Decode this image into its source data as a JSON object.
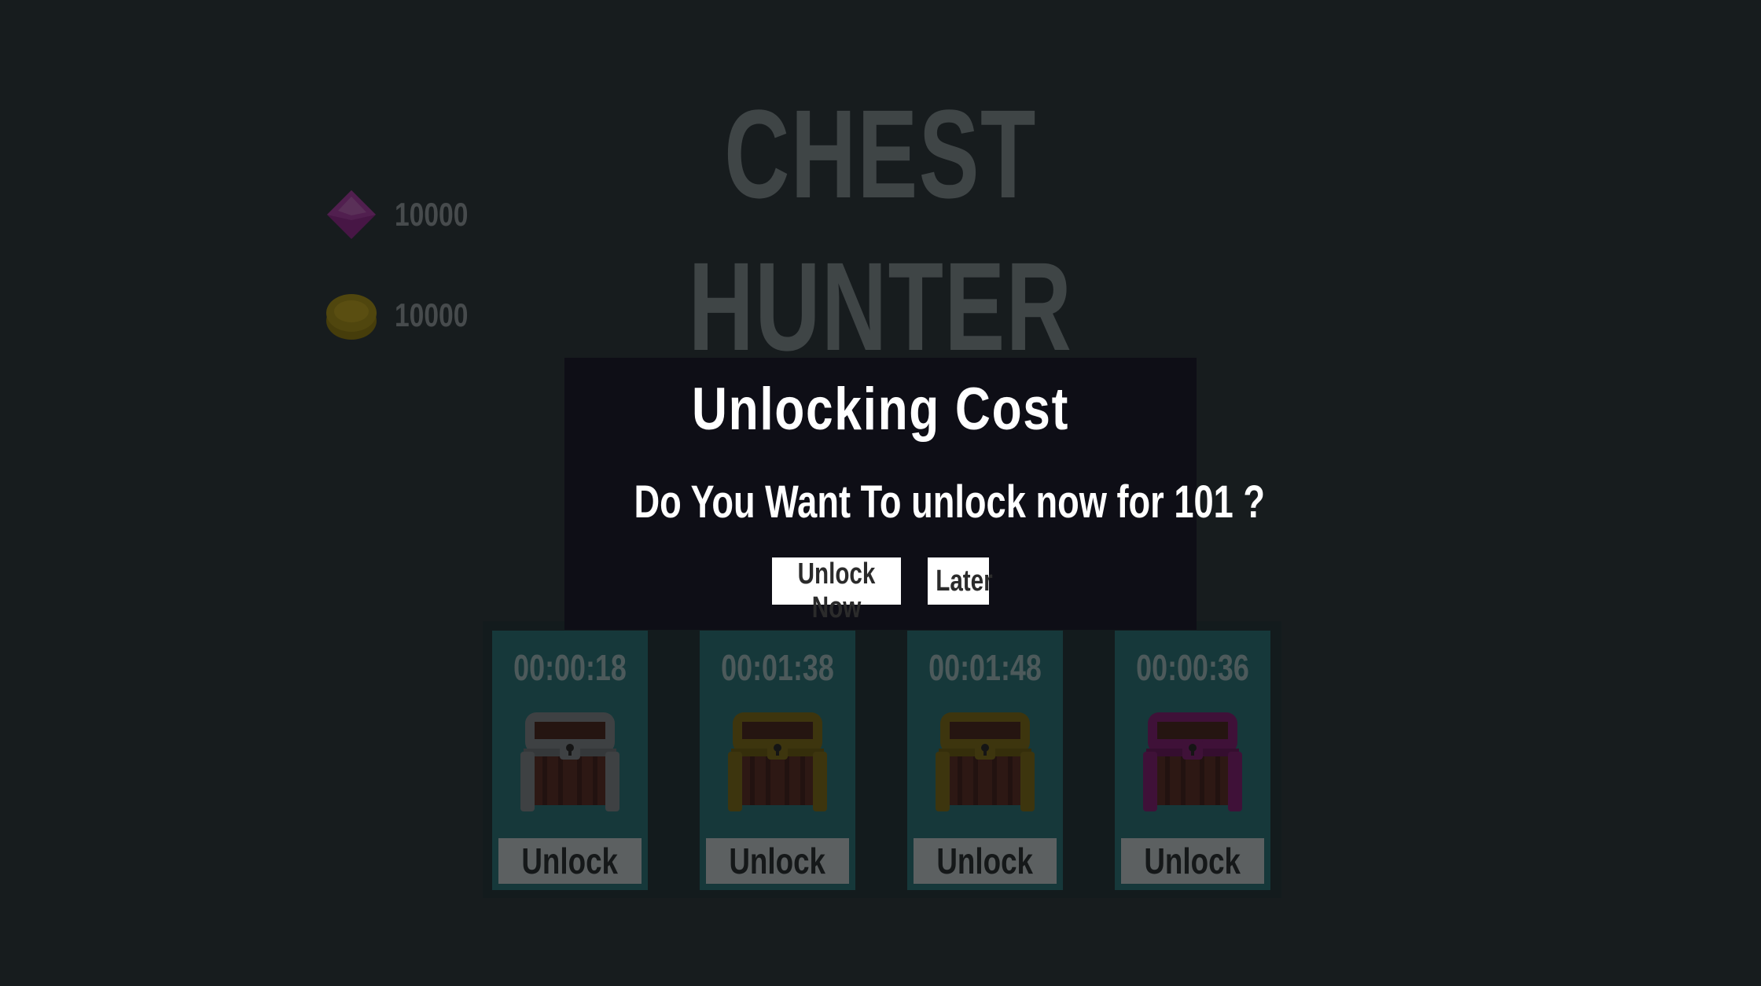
{
  "game": {
    "title_line1": "CHEST",
    "title_line2": "HUNTER"
  },
  "currencies": {
    "gems": "10000",
    "coins": "10000"
  },
  "chests": [
    {
      "timer": "00:00:18",
      "button": "Unlock",
      "color": "silver",
      "frame": "#7d8286"
    },
    {
      "timer": "00:01:38",
      "button": "Unlock",
      "color": "gold",
      "frame": "#7a6b1d"
    },
    {
      "timer": "00:01:48",
      "button": "Unlock",
      "color": "gold",
      "frame": "#7a6b1d"
    },
    {
      "timer": "00:00:36",
      "button": "Unlock",
      "color": "magenta",
      "frame": "#7e2271"
    }
  ],
  "modal": {
    "title": "Unlocking Cost",
    "message": "Do You Want To unlock now for 101 ?",
    "unlock_now": "Unlock Now",
    "later": "Later"
  },
  "icons": {
    "gem": "gem-icon",
    "coin": "coin-icon",
    "chest": "treasure-chest-icon"
  },
  "colors": {
    "background": "#2e383c",
    "modal_bg": "#0e0e16",
    "card_bg": "#2d7075"
  }
}
